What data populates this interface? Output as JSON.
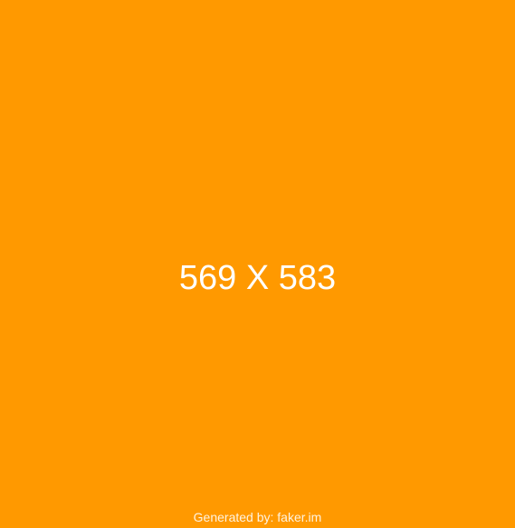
{
  "placeholder": {
    "dimensions_text": "569 X 583",
    "generated_by": "Generated by: faker.im",
    "background_color": "#FF9900",
    "text_color": "#FFFFFF"
  }
}
